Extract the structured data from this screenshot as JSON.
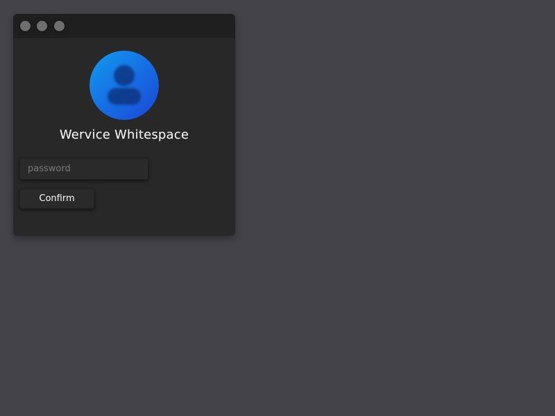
{
  "window": {
    "controls": [
      {
        "icon": "window-control-icon"
      },
      {
        "icon": "window-control-icon"
      },
      {
        "icon": "window-control-icon"
      }
    ]
  },
  "user": {
    "name": "Wervice Whitespace",
    "avatar_icon": "user-avatar-icon",
    "avatar_gradient": [
      "#129bf0",
      "#1a45d6"
    ]
  },
  "login": {
    "password_placeholder": "password",
    "password_value": "",
    "confirm_label": "Confirm"
  },
  "colors": {
    "desktop_background": "#434349",
    "window_background": "#282828",
    "titlebar_background": "#1f1f1f",
    "control_button": "#6e6e6e"
  }
}
